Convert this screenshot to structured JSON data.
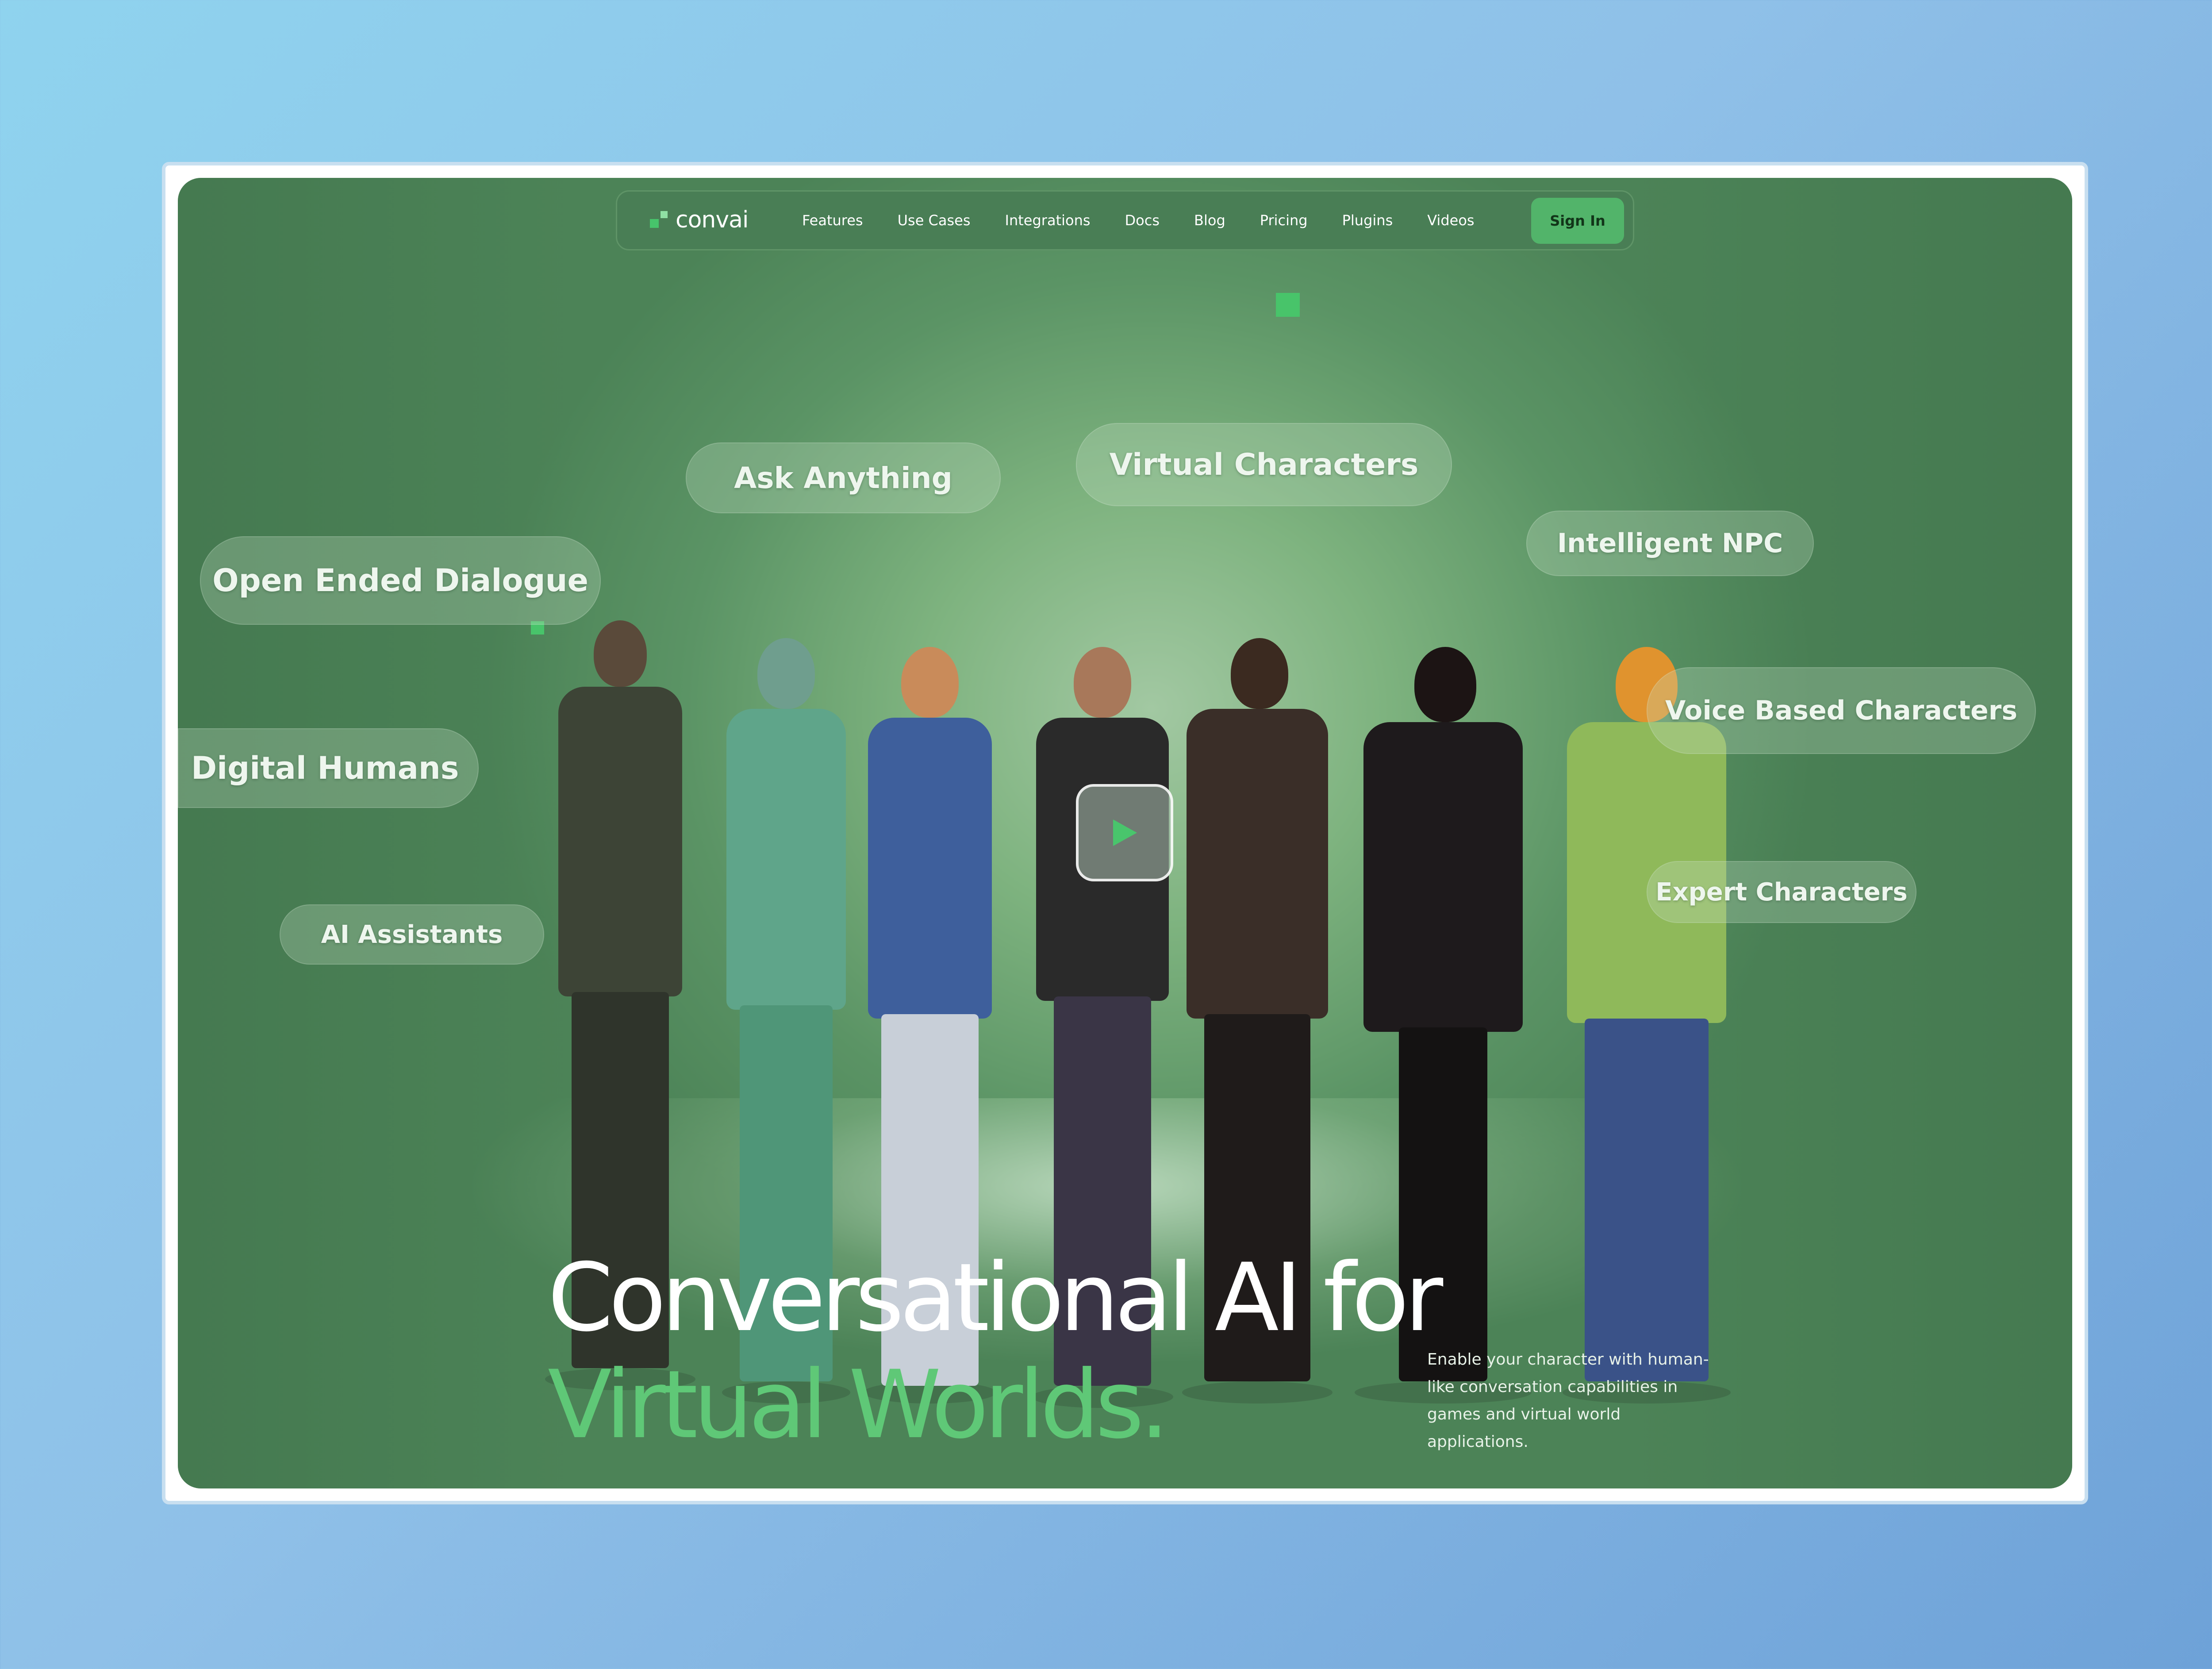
{
  "nav": {
    "logo": {
      "text": "convai",
      "icon": "convai-logo-icon"
    },
    "links": [
      "Features",
      "Use Cases",
      "Integrations",
      "Docs",
      "Blog",
      "Pricing",
      "Plugins",
      "Videos"
    ],
    "sign_in_label": "Sign In"
  },
  "tags": {
    "ask_anything": "Ask Anything",
    "virtual_characters": "Virtual Characters",
    "intelligent_npc": "Intelligent NPC",
    "open_ended_dialogue": "Open Ended Dialogue",
    "voice_based_characters": "Voice Based Characters",
    "digital_humans": "Digital Humans",
    "expert_characters": "Expert Characters",
    "ai_assistants": "AI Assistants"
  },
  "hero": {
    "headline_line1": "Conversational AI for",
    "headline_line2": "Virtual Worlds.",
    "description": "Enable your character with human-like conversation capabilities in games and virtual world applications.",
    "play_icon": "play-icon"
  },
  "colors": {
    "accent": "#5fc877",
    "sign_in_bg": "#52b46a",
    "nav_bg": "#497e55",
    "backdrop": "#6ea2d8"
  }
}
